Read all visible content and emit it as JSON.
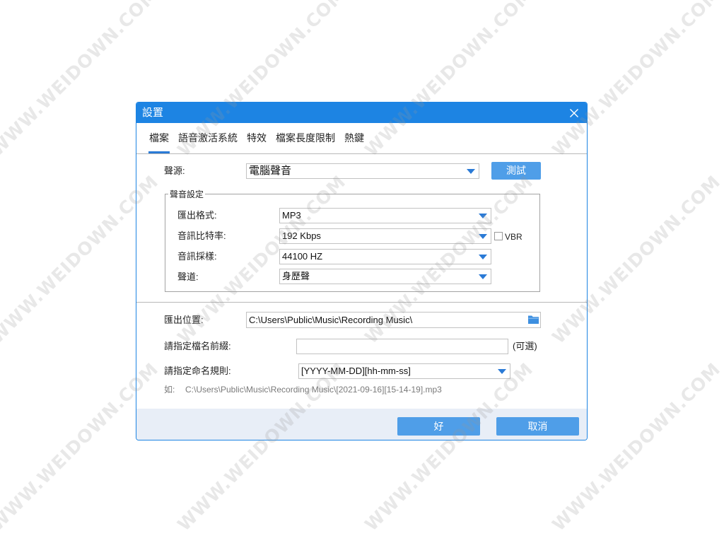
{
  "watermark": "WWW.WEIDOWN.COM",
  "dialog": {
    "title": "設置"
  },
  "tabs": [
    {
      "label": "檔案",
      "active": true
    },
    {
      "label": "語音激活系統",
      "active": false
    },
    {
      "label": "特效",
      "active": false
    },
    {
      "label": "檔案長度限制",
      "active": false
    },
    {
      "label": "熱鍵",
      "active": false
    }
  ],
  "source": {
    "label": "聲源:",
    "value": "電腦聲音",
    "test_button": "測試"
  },
  "sound_settings": {
    "legend": "聲音設定",
    "format": {
      "label": "匯出格式:",
      "value": "MP3"
    },
    "bitrate": {
      "label": "音訊比特率:",
      "value": "192 Kbps",
      "vbr_label": "VBR",
      "vbr_checked": false
    },
    "sample_rate": {
      "label": "音訊採樣:",
      "value": "44100 HZ"
    },
    "channel": {
      "label": "聲道:",
      "value": "身歷聲"
    }
  },
  "output": {
    "location_label": "匯出位置:",
    "location_value": "C:\\Users\\Public\\Music\\Recording Music\\",
    "prefix_label": "請指定檔名前綴:",
    "prefix_value": "",
    "prefix_optional": "(可選)",
    "naming_label": "請指定命名規則:",
    "naming_value": "[YYYY-MM-DD][hh-mm-ss]",
    "example_label": "如:",
    "example_value": "C:\\Users\\Public\\Music\\Recording Music\\[2021-09-16][15-14-19].mp3"
  },
  "footer": {
    "ok_button": "好",
    "cancel_button": "取消"
  },
  "icons": {
    "close": "close-icon",
    "dropdown": "chevron-down-icon",
    "folder": "folder-icon"
  },
  "colors": {
    "title_bar": "#1d84e3",
    "button": "#4f9ee8",
    "footer_bg": "#e8eef7",
    "accent": "#2a7ad6"
  }
}
